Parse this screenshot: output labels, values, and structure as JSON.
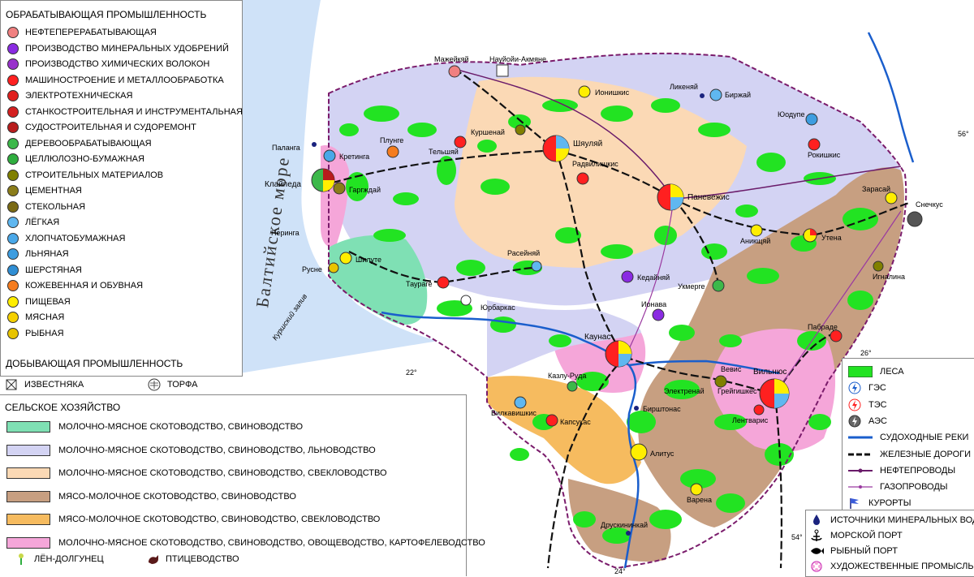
{
  "colors": {
    "sea": "#cfe2f8",
    "forest": "#22e322",
    "cattle_pig": "#7fe0b4",
    "cattle_pig_flax": "#d3d3f3",
    "cattle_pig_beet": "#fbd9b5",
    "meat_pig": "#c79f81",
    "meat_pig_beet": "#f6bb5f",
    "vegetable": "#f5a6d9",
    "rivers": "#1a5ecc",
    "railway": "#111111",
    "oil_pipe": "#6a1b6a",
    "gas_pipe": "#9a3aa0"
  },
  "legend_left": {
    "manufacturing_title": "ОБРАБАТЫВАЮЩАЯ ПРОМЫШЛЕННОСТЬ",
    "industries": [
      {
        "label": "НЕФТЕПЕРЕРАБАТЫВАЮЩАЯ",
        "color": "#f08080",
        "icon": "oil-refining-icon"
      },
      {
        "label": "ПРОИЗВОДСТВО МИНЕРАЛЬНЫХ УДОБРЕНИЙ",
        "color": "#8a2be2",
        "icon": "fertilizer-icon"
      },
      {
        "label": "ПРОИЗВОДСТВО ХИМИЧЕСКИХ ВОЛОКОН",
        "color": "#9932cc",
        "icon": "chemical-fiber-icon"
      },
      {
        "label": "МАШИНОСТРОЕНИЕ И МЕТАЛЛООБРАБОТКА",
        "color": "#ff2020",
        "icon": "machinery-icon"
      },
      {
        "label": "ЭЛЕКТРОТЕХНИЧЕСКАЯ",
        "color": "#e0201e",
        "icon": "electrotechnical-icon"
      },
      {
        "label": "СТАНКОСТРОИТЕЛЬНАЯ И ИНСТРУМЕНТАЛЬНАЯ",
        "color": "#d42020",
        "icon": "machine-tool-icon"
      },
      {
        "label": "СУДОСТРОИТЕЛЬНАЯ И СУДОРЕМОНТ",
        "color": "#b81c1c",
        "icon": "shipbuilding-icon"
      },
      {
        "label": "ДЕРЕВООБРАБАТЫВАЮЩАЯ",
        "color": "#3cb84a",
        "icon": "woodworking-icon"
      },
      {
        "label": "ЦЕЛЛЮЛОЗНО-БУМАЖНАЯ",
        "color": "#2fae3f",
        "icon": "pulp-paper-icon"
      },
      {
        "label": "СТРОИТЕЛЬНЫХ МАТЕРИАЛОВ",
        "color": "#808000",
        "icon": "construction-materials-icon"
      },
      {
        "label": "ЦЕМЕНТНАЯ",
        "color": "#8b7d1a",
        "icon": "cement-icon"
      },
      {
        "label": "СТЕКОЛЬНАЯ",
        "color": "#7a6a14",
        "icon": "glass-icon"
      },
      {
        "label": "ЛЁГКАЯ",
        "color": "#5fb7f0",
        "icon": "light-industry-icon"
      },
      {
        "label": "ХЛОПЧАТОБУМАЖНАЯ",
        "color": "#4aa8e8",
        "icon": "cotton-icon"
      },
      {
        "label": "ЛЬНЯНАЯ",
        "color": "#3d9de0",
        "icon": "linen-icon"
      },
      {
        "label": "ШЕРСТЯНАЯ",
        "color": "#2f8ed4",
        "icon": "wool-icon"
      },
      {
        "label": "КОЖЕВЕННАЯ И ОБУВНАЯ",
        "color": "#f57c1f",
        "icon": "leather-shoe-icon"
      },
      {
        "label": "ПИЩЕВАЯ",
        "color": "#ffee00",
        "icon": "food-icon"
      },
      {
        "label": "МЯСНАЯ",
        "color": "#f5d000",
        "icon": "meat-icon"
      },
      {
        "label": "РЫБНАЯ",
        "color": "#e8c400",
        "icon": "fish-icon"
      }
    ],
    "mining_title": "ДОБЫВАЮЩАЯ ПРОМЫШЛЕННОСТЬ",
    "mining": [
      {
        "label": "ИЗВЕСТНЯКА",
        "icon": "limestone-icon"
      },
      {
        "label": "ТОРФА",
        "icon": "peat-icon"
      }
    ]
  },
  "legend_bottom": {
    "title": "СЕЛЬСКОЕ ХОЗЯЙСТВО",
    "zones": [
      {
        "label": "МОЛОЧНО-МЯСНОЕ СКОТОВОДСТВО, СВИНОВОДСТВО",
        "color": "#7fe0b4"
      },
      {
        "label": "МОЛОЧНО-МЯСНОЕ СКОТОВОДСТВО, СВИНОВОДСТВО, ЛЬНОВОДСТВО",
        "color": "#d3d3f3"
      },
      {
        "label": "МОЛОЧНО-МЯСНОЕ СКОТОВОДСТВО, СВИНОВОДСТВО, СВЕКЛОВОДСТВО",
        "color": "#fbd9b5"
      },
      {
        "label": "МЯСО-МОЛОЧНОЕ СКОТОВОДСТВО, СВИНОВОДСТВО",
        "color": "#c79f81"
      },
      {
        "label": "МЯСО-МОЛОЧНОЕ СКОТОВОДСТВО, СВИНОВОДСТВО, СВЕКЛОВОДСТВО",
        "color": "#f6bb5f"
      },
      {
        "label": "МОЛОЧНО-МЯСНОЕ СКОТОВОДСТВО, СВИНОВОДСТВО, ОВОЩЕВОДСТВО, КАРТОФЕЛЕВОДСТВО",
        "color": "#f5a6d9"
      }
    ],
    "flax_label": "ЛЁН-ДОЛГУНЕЦ",
    "poultry_label": "ПТИЦЕВОДСТВО"
  },
  "legend_right": {
    "items": [
      {
        "label": "ЛЕСА",
        "icon": "forest-swatch-icon"
      },
      {
        "label": "ГЭС",
        "icon": "hydro-plant-icon"
      },
      {
        "label": "ТЭС",
        "icon": "thermal-plant-icon"
      },
      {
        "label": "АЭС",
        "icon": "nuclear-plant-icon"
      },
      {
        "label": "СУДОХОДНЫЕ РЕКИ",
        "icon": "navigable-river-icon"
      },
      {
        "label": "ЖЕЛЕЗНЫЕ ДОРОГИ",
        "icon": "railway-icon"
      },
      {
        "label": "НЕФТЕПРОВОДЫ",
        "icon": "oil-pipeline-icon"
      },
      {
        "label": "ГАЗОПРОВОДЫ",
        "icon": "gas-pipeline-icon"
      },
      {
        "label": "КУРОРТЫ",
        "icon": "resort-flag-icon"
      }
    ],
    "items2": [
      {
        "label": "ИСТОЧНИКИ МИНЕРАЛЬНЫХ ВОД",
        "icon": "mineral-spring-icon"
      },
      {
        "label": "МОРСКОЙ ПОРТ",
        "icon": "anchor-icon"
      },
      {
        "label": "РЫБНЫЙ ПОРТ",
        "icon": "fish-port-icon"
      },
      {
        "label": "ХУДОЖЕСТВЕННЫЕ ПРОМЫСЛЫ",
        "icon": "artistic-crafts-icon"
      }
    ]
  },
  "sea_label": "Балтийское море",
  "lagoon_label": "Куршский залив",
  "coords": {
    "lat56": "56°",
    "lon22": "22°",
    "lon24": "24°",
    "lon26": "26°",
    "lat54": "54°"
  },
  "cities": [
    {
      "name": "Мажейкяй",
      "big": false
    },
    {
      "name": "Науйойи-Акмяне",
      "big": false
    },
    {
      "name": "Ионишкис",
      "big": false
    },
    {
      "name": "Ликеняй",
      "big": false
    },
    {
      "name": "Биржай",
      "big": false
    },
    {
      "name": "Юодупе",
      "big": false
    },
    {
      "name": "Паланга",
      "big": false
    },
    {
      "name": "Кретинга",
      "big": false
    },
    {
      "name": "Плунге",
      "big": false
    },
    {
      "name": "Куршенай",
      "big": false
    },
    {
      "name": "Тельшяй",
      "big": false
    },
    {
      "name": "Шяуляй",
      "big": true
    },
    {
      "name": "Радвилишкис",
      "big": false
    },
    {
      "name": "Рокишкис",
      "big": false
    },
    {
      "name": "Клайпеда",
      "big": true
    },
    {
      "name": "Гаргждай",
      "big": false
    },
    {
      "name": "Паневежис",
      "big": true
    },
    {
      "name": "Зарасай",
      "big": false
    },
    {
      "name": "Снечкус",
      "big": false
    },
    {
      "name": "Неринга",
      "big": false
    },
    {
      "name": "Аникщяй",
      "big": false
    },
    {
      "name": "Утена",
      "big": false
    },
    {
      "name": "Шилуте",
      "big": false
    },
    {
      "name": "Русне",
      "big": false
    },
    {
      "name": "Расейняй",
      "big": false
    },
    {
      "name": "Таураге",
      "big": false
    },
    {
      "name": "Кедайняй",
      "big": false
    },
    {
      "name": "Укмерге",
      "big": false
    },
    {
      "name": "Игналина",
      "big": false
    },
    {
      "name": "Юрбаркас",
      "big": false
    },
    {
      "name": "Ионава",
      "big": false
    },
    {
      "name": "Пабраде",
      "big": false
    },
    {
      "name": "Каунас",
      "big": true
    },
    {
      "name": "Казлу-Руда",
      "big": false
    },
    {
      "name": "Вевис",
      "big": false
    },
    {
      "name": "Грейгишкес",
      "big": false
    },
    {
      "name": "Вильнюс",
      "big": true
    },
    {
      "name": "Электренай",
      "big": false
    },
    {
      "name": "Вилкавишкис",
      "big": false
    },
    {
      "name": "Капсукас",
      "big": false
    },
    {
      "name": "Бирштонас",
      "big": false
    },
    {
      "name": "Лентварис",
      "big": false
    },
    {
      "name": "Алитус",
      "big": false
    },
    {
      "name": "Варена",
      "big": false
    },
    {
      "name": "Друскининкай",
      "big": false
    }
  ]
}
